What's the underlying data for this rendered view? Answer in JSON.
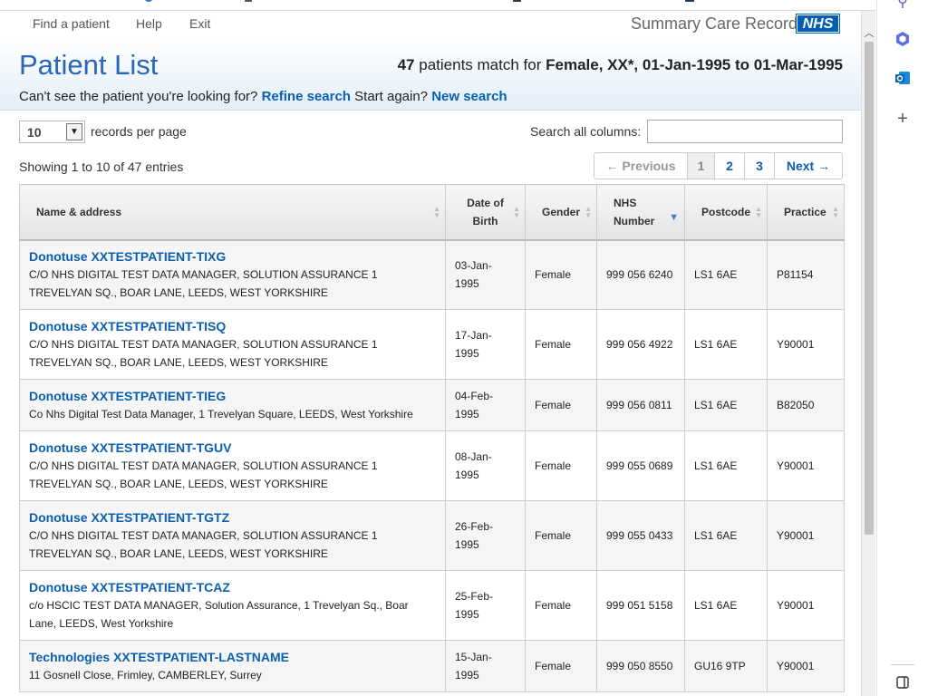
{
  "nav": {
    "links": [
      "Find a patient",
      "Help",
      "Exit"
    ],
    "brand": "Summary Care Record",
    "logo": "NHS"
  },
  "header": {
    "title": "Patient List",
    "match_count": "47",
    "match_text": "patients match for",
    "match_criteria": "Female, XX*, 01-Jan-1995 to 01-Mar-1995",
    "cant_see": "Can't see the patient you're looking for?",
    "refine_link": "Refine search",
    "start_again": "Start again?",
    "new_search_link": "New search"
  },
  "controls": {
    "per_page_value": "10",
    "per_page_label": "records per page",
    "search_label": "Search all columns:",
    "search_value": "",
    "showing": "Showing 1 to 10 of 47 entries"
  },
  "pager": {
    "previous": "← Previous",
    "pages": [
      "1",
      "2",
      "3"
    ],
    "next": "Next →"
  },
  "table": {
    "headers": {
      "name": "Name & address",
      "dob": "Date of Birth",
      "gender": "Gender",
      "nhs": "NHS Number",
      "postcode": "Postcode",
      "practice": "Practice"
    },
    "rows": [
      {
        "name": "Donotuse XXTESTPATIENT-TIXG",
        "address": "C/O NHS DIGITAL TEST DATA MANAGER, SOLUTION ASSURANCE 1 TREVELYAN SQ., BOAR LANE, LEEDS, WEST YORKSHIRE",
        "dob": "03-Jan-1995",
        "gender": "Female",
        "nhs": "999 056 6240",
        "postcode": "LS1 6AE",
        "practice": "P81154"
      },
      {
        "name": "Donotuse XXTESTPATIENT-TISQ",
        "address": "C/O NHS DIGITAL TEST DATA MANAGER, SOLUTION ASSURANCE 1 TREVELYAN SQ., BOAR LANE, LEEDS, WEST YORKSHIRE",
        "dob": "17-Jan-1995",
        "gender": "Female",
        "nhs": "999 056 4922",
        "postcode": "LS1 6AE",
        "practice": "Y90001"
      },
      {
        "name": "Donotuse XXTESTPATIENT-TIEG",
        "address": "Co Nhs Digital Test Data Manager, 1 Trevelyan Square, LEEDS, West Yorkshire",
        "dob": "04-Feb-1995",
        "gender": "Female",
        "nhs": "999 056 0811",
        "postcode": "LS1 6AE",
        "practice": "B82050"
      },
      {
        "name": "Donotuse XXTESTPATIENT-TGUV",
        "address": "C/O NHS DIGITAL TEST DATA MANAGER, SOLUTION ASSURANCE 1 TREVELYAN SQ., BOAR LANE, LEEDS, WEST YORKSHIRE",
        "dob": "08-Jan-1995",
        "gender": "Female",
        "nhs": "999 055 0689",
        "postcode": "LS1 6AE",
        "practice": "Y90001"
      },
      {
        "name": "Donotuse XXTESTPATIENT-TGTZ",
        "address": "C/O NHS DIGITAL TEST DATA MANAGER, SOLUTION ASSURANCE 1 TREVELYAN SQ., BOAR LANE, LEEDS, WEST YORKSHIRE",
        "dob": "26-Feb-1995",
        "gender": "Female",
        "nhs": "999 055 0433",
        "postcode": "LS1 6AE",
        "practice": "Y90001"
      },
      {
        "name": "Donotuse XXTESTPATIENT-TCAZ",
        "address": "c/o HSCIC TEST DATA MANAGER, Solution Assurance, 1 Trevelyan Sq., Boar Lane, LEEDS, West Yorkshire",
        "dob": "25-Feb-1995",
        "gender": "Female",
        "nhs": "999 051 5158",
        "postcode": "LS1 6AE",
        "practice": "Y90001"
      },
      {
        "name": "Technologies XXTESTPATIENT-LASTNAME",
        "address": "11 Gosnell Close, Frimley, CAMBERLEY, Surrey",
        "dob": "15-Jan-1995",
        "gender": "Female",
        "nhs": "999 050 8550",
        "postcode": "GU16 9TP",
        "practice": "Y90001"
      }
    ]
  },
  "sidebar": {
    "icons": [
      "search-icon",
      "copilot-icon",
      "outlook-icon",
      "add-icon",
      "panel-icon"
    ]
  }
}
